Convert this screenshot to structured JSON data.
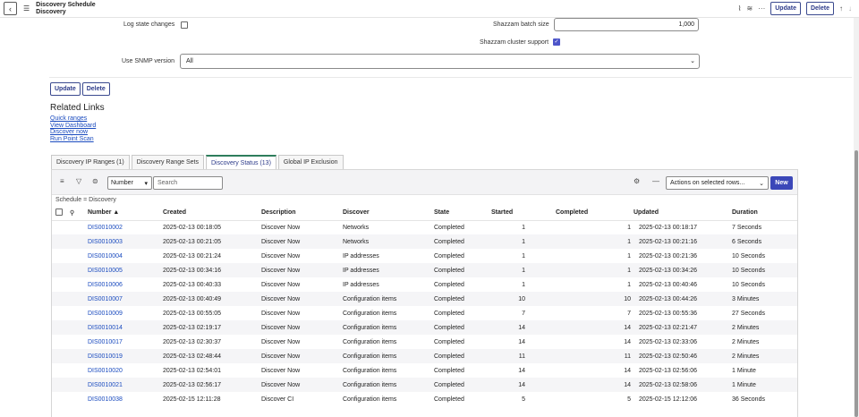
{
  "header": {
    "title_line1": "Discovery Schedule",
    "title_line2": "Discovery",
    "update_label": "Update",
    "delete_label": "Delete",
    "more_label": "···"
  },
  "form": {
    "log_state_changes_label": "Log state changes",
    "shazzam_batch_size_label": "Shazzam batch size",
    "shazzam_batch_size_value": "1,000",
    "shazzam_cluster_support_label": "Shazzam cluster support",
    "use_snmp_version_label": "Use SNMP version",
    "use_snmp_version_value": "All"
  },
  "form_buttons": {
    "update_label": "Update",
    "delete_label": "Delete"
  },
  "related_links": {
    "title": "Related Links",
    "links": [
      "Quick ranges",
      "View Dashboard",
      "Discover now",
      "Run Point Scan"
    ]
  },
  "tabs": [
    {
      "label": "Discovery IP Ranges (1)"
    },
    {
      "label": "Discovery Range Sets"
    },
    {
      "label": "Discovery Status (13)"
    },
    {
      "label": "Global IP Exclusion"
    }
  ],
  "list": {
    "search_field": "Number",
    "search_placeholder": "Search",
    "actions_label": "Actions on selected rows...",
    "new_label": "New",
    "breadcrumb": "Schedule = Discovery",
    "columns": [
      "Number ▲",
      "Created",
      "Description",
      "Discover",
      "State",
      "Started",
      "Completed",
      "Updated",
      "Duration"
    ],
    "rows": [
      [
        "DIS0010002",
        "2025-02-13 00:18:05",
        "Discover Now",
        "Networks",
        "Completed",
        "1",
        "1",
        "2025-02-13 00:18:17",
        "7 Seconds"
      ],
      [
        "DIS0010003",
        "2025-02-13 00:21:05",
        "Discover Now",
        "Networks",
        "Completed",
        "1",
        "1",
        "2025-02-13 00:21:16",
        "6 Seconds"
      ],
      [
        "DIS0010004",
        "2025-02-13 00:21:24",
        "Discover Now",
        "IP addresses",
        "Completed",
        "1",
        "1",
        "2025-02-13 00:21:36",
        "10 Seconds"
      ],
      [
        "DIS0010005",
        "2025-02-13 00:34:16",
        "Discover Now",
        "IP addresses",
        "Completed",
        "1",
        "1",
        "2025-02-13 00:34:26",
        "10 Seconds"
      ],
      [
        "DIS0010006",
        "2025-02-13 00:40:33",
        "Discover Now",
        "IP addresses",
        "Completed",
        "1",
        "1",
        "2025-02-13 00:40:46",
        "10 Seconds"
      ],
      [
        "DIS0010007",
        "2025-02-13 00:40:49",
        "Discover Now",
        "Configuration items",
        "Completed",
        "10",
        "10",
        "2025-02-13 00:44:26",
        "3 Minutes"
      ],
      [
        "DIS0010009",
        "2025-02-13 00:55:05",
        "Discover Now",
        "Configuration items",
        "Completed",
        "7",
        "7",
        "2025-02-13 00:55:36",
        "27 Seconds"
      ],
      [
        "DIS0010014",
        "2025-02-13 02:19:17",
        "Discover Now",
        "Configuration items",
        "Completed",
        "14",
        "14",
        "2025-02-13 02:21:47",
        "2 Minutes"
      ],
      [
        "DIS0010017",
        "2025-02-13 02:30:37",
        "Discover Now",
        "Configuration items",
        "Completed",
        "14",
        "14",
        "2025-02-13 02:33:06",
        "2 Minutes"
      ],
      [
        "DIS0010019",
        "2025-02-13 02:48:44",
        "Discover Now",
        "Configuration items",
        "Completed",
        "11",
        "11",
        "2025-02-13 02:50:46",
        "2 Minutes"
      ],
      [
        "DIS0010020",
        "2025-02-13 02:54:01",
        "Discover Now",
        "Configuration items",
        "Completed",
        "14",
        "14",
        "2025-02-13 02:56:06",
        "1 Minute"
      ],
      [
        "DIS0010021",
        "2025-02-13 02:56:17",
        "Discover Now",
        "Configuration items",
        "Completed",
        "14",
        "14",
        "2025-02-13 02:58:06",
        "1 Minute"
      ],
      [
        "DIS0010038",
        "2025-02-15 12:11:28",
        "Discover CI",
        "Configuration items",
        "Completed",
        "5",
        "5",
        "2025-02-15 12:12:06",
        "36 Seconds"
      ]
    ]
  },
  "icons": {
    "back": "chevron-left-icon",
    "menu": "hamburger-icon",
    "attachment": "paperclip-icon",
    "settings": "sliders-icon",
    "more": "more-icon",
    "up": "arrow-up-icon",
    "down": "arrow-down-icon"
  },
  "colors": {
    "accent": "#3b47b8",
    "link": "#1a4bbf",
    "active_tab": "#2e7d5c"
  }
}
